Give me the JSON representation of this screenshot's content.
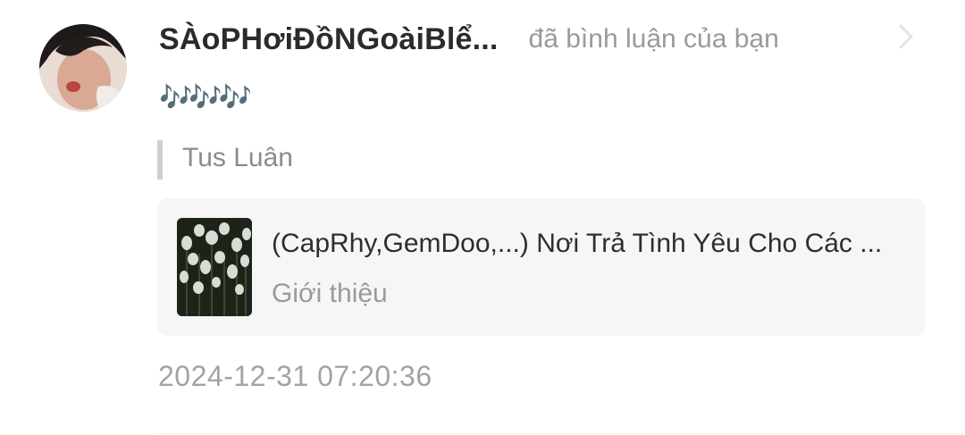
{
  "notification": {
    "username": "SÀoPHơiĐồNGoàiBlể...",
    "action": "đã bình luận của bạn",
    "comment": "🎶🎶🎶",
    "quoted_author": "Tus Luân",
    "card": {
      "title": "(CapRhy,GemDoo,...) Nơi Trả Tình Yêu Cho Các ...",
      "subtitle": "Giới thiệu"
    },
    "timestamp": "2024-12-31 07:20:36"
  },
  "icons": {
    "avatar": "user-avatar",
    "chevron": "chevron-right-icon",
    "thumbnail": "tulip-thumbnail"
  },
  "colors": {
    "username": "#2b2b2b",
    "secondary_text": "#9a9a9a",
    "comment_notes": "#4a5f6e",
    "card_background": "#f6f6f6"
  }
}
